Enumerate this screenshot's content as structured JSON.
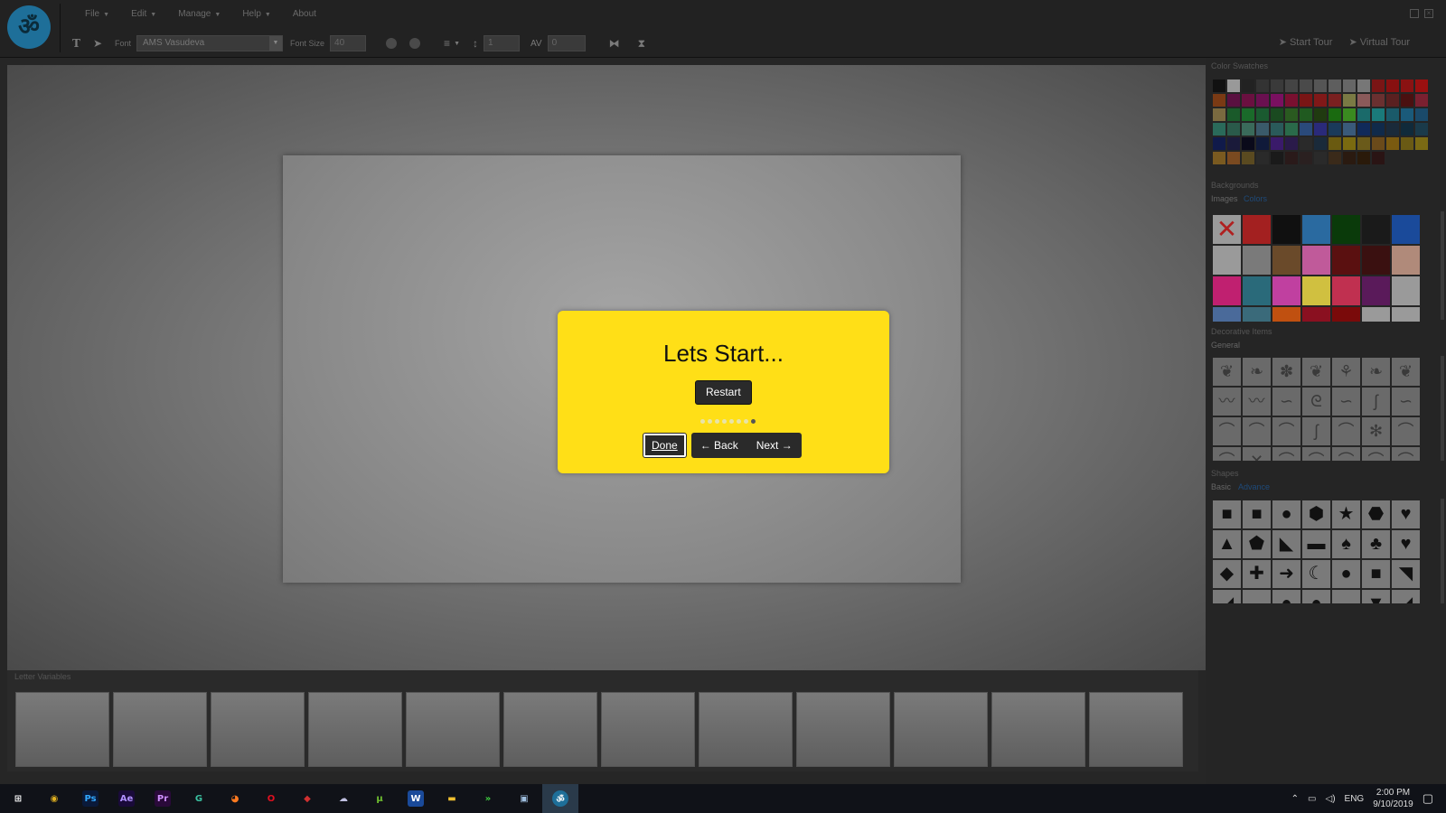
{
  "menu": {
    "items": [
      {
        "label": "File",
        "caret": true
      },
      {
        "label": "Edit",
        "caret": true
      },
      {
        "label": "Manage",
        "caret": true
      },
      {
        "label": "Help",
        "caret": true
      },
      {
        "label": "About",
        "caret": false
      }
    ]
  },
  "toolbar": {
    "font_label": "Font",
    "font_value": "AMS Vasudeva",
    "font_size_label": "Font Size",
    "font_size_value": "40",
    "line_height_value": "1",
    "letter_spacing_value": "0"
  },
  "tour_links": {
    "start": "Start Tour",
    "virtual": "Virtual Tour"
  },
  "tour_dialog": {
    "title": "Lets Start...",
    "restart": "Restart",
    "done": "Done",
    "back": "← Back",
    "next": "Next →",
    "step_count": 8,
    "active_step": 8
  },
  "letter_variables": {
    "title": "Letter Variables",
    "slot_count": 12
  },
  "panel": {
    "color_swatches_title": "Color Swatches",
    "swatch_colors": [
      "#111111",
      "#999999",
      "#222222",
      "#333333",
      "#3a3a3a",
      "#444444",
      "#4a4a4a",
      "#555555",
      "#5e5e5e",
      "#666666",
      "#777777",
      "#7a1515",
      "#881010",
      "#8a1212",
      "#9a1010",
      "#7a3a14",
      "#5a1040",
      "#6a1040",
      "#6a1050",
      "#7a1060",
      "#7a1030",
      "#7a1515",
      "#801818",
      "#7a2020",
      "#7a7a44",
      "#8a5a5a",
      "#6a3030",
      "#5a2020",
      "#4a1010",
      "#7a2030",
      "#7a6a40",
      "#1a5a2a",
      "#1a6a2a",
      "#1a5a30",
      "#1a4a20",
      "#2a5a20",
      "#205a20",
      "#203a10",
      "#1a6a10",
      "#3a8a20",
      "#1a6a6a",
      "#1a7a7a",
      "#1a5a6a",
      "#1a5a7a",
      "#1a4a6a",
      "#2a6a5a",
      "#2a5a4a",
      "#3a6a5a",
      "#3a5a6a",
      "#2a5a5a",
      "#2a6a4a",
      "#2a4a7a",
      "#2a2a7a",
      "#1a3a5a",
      "#3a5a7a",
      "#102a5a",
      "#102a4a",
      "#1a2a3a",
      "#102a3a",
      "#1a3a4a",
      "#101a4a",
      "#1a1a3a",
      "#0a0a1a",
      "#101a3a",
      "#3a1a6a",
      "#2a1a4a",
      "#2a2a2a",
      "#1a2a3a",
      "#6a5a10",
      "#7a6a10",
      "#6a5a1a",
      "#6a4a1a",
      "#7a5a10",
      "#6a5a14",
      "#7a6a14",
      "#7a5a20",
      "#7a4a20",
      "#5a4a20",
      "#2a2a2a",
      "#1a1a1a",
      "#2a1a1a",
      "#2a2020",
      "#2a2a2a",
      "#3a2a1a",
      "#2a1a10",
      "#2a1a0a",
      "#2a1414"
    ],
    "backgrounds_title": "Backgrounds",
    "bg_tabs": {
      "images": "Images",
      "colors": "Colors"
    },
    "bg_thumbs": [
      "#8a8a8a",
      "#a32020",
      "#101010",
      "#2a6aa0",
      "#0a3a0a",
      "#1a1a1a",
      "#1a4a9a",
      "#9a9a9a",
      "#7a7a7a",
      "#6a4a2a",
      "#c05a9a",
      "#5a1010",
      "#3a1010",
      "#b08a7a",
      "#c02070",
      "#2a6a7a",
      "#c040a0",
      "#d0c040",
      "#c03050",
      "#5a1a5a",
      "#9a9a9a",
      "#4a6a9a",
      "#3a6a7a",
      "#c05010",
      "#8a1020",
      "#7a0a0a",
      "#9a9a9a",
      "#9a9a9a"
    ],
    "decorative_title": "Decorative Items",
    "deco_tab": "General",
    "deco_glyphs": [
      "❦",
      "❧",
      "✽",
      "❦",
      "⚘",
      "❧",
      "❦",
      "〰",
      "〰",
      "∽",
      "ᘓ",
      "∽",
      "ʃ",
      "∽",
      "⌒",
      "⌒",
      "⌒",
      "ʃ",
      "⌒",
      "✻",
      "⌒",
      "⌒",
      "✕",
      "⌒",
      "⌒",
      "⌒",
      "⌒",
      "⌒"
    ],
    "shapes_title": "Shapes",
    "shape_tabs": {
      "basic": "Basic",
      "advance": "Advance"
    },
    "shape_glyphs": [
      "■",
      "■",
      "●",
      "⬢",
      "★",
      "⬣",
      "♥",
      "▲",
      "⬟",
      "◣",
      "▬",
      "♠",
      "♣",
      "♥",
      "◆",
      "✚",
      "➜",
      "☾",
      "●",
      "■",
      "◥",
      "◢",
      "▬",
      "●",
      "●",
      "▬",
      "▼",
      "◢"
    ]
  },
  "taskbar": {
    "apps": [
      {
        "name": "windows-start",
        "glyph": "⊞",
        "bg": "transparent",
        "fg": "#ffffff"
      },
      {
        "name": "chrome",
        "glyph": "◉",
        "bg": "transparent",
        "fg": "#e0b020"
      },
      {
        "name": "photoshop",
        "glyph": "Ps",
        "bg": "#0a1a3a",
        "fg": "#31a8ff"
      },
      {
        "name": "after-effects",
        "glyph": "Ae",
        "bg": "#1a0a3a",
        "fg": "#b090ff"
      },
      {
        "name": "premiere",
        "glyph": "Pr",
        "bg": "#2a0a3a",
        "fg": "#d090ff"
      },
      {
        "name": "grammarly",
        "glyph": "G",
        "bg": "transparent",
        "fg": "#3ac0a0"
      },
      {
        "name": "firefox",
        "glyph": "◕",
        "bg": "transparent",
        "fg": "#ff7a20"
      },
      {
        "name": "opera",
        "glyph": "O",
        "bg": "transparent",
        "fg": "#e01020"
      },
      {
        "name": "git",
        "glyph": "◆",
        "bg": "transparent",
        "fg": "#d03030"
      },
      {
        "name": "app-brain",
        "glyph": "☁",
        "bg": "transparent",
        "fg": "#c0c0e0"
      },
      {
        "name": "utorrent",
        "glyph": "μ",
        "bg": "transparent",
        "fg": "#70c030"
      },
      {
        "name": "word",
        "glyph": "W",
        "bg": "#1a4a9a",
        "fg": "#ffffff"
      },
      {
        "name": "file-explorer",
        "glyph": "▬",
        "bg": "transparent",
        "fg": "#f0c030"
      },
      {
        "name": "green-arrow-app",
        "glyph": "»",
        "bg": "transparent",
        "fg": "#40d040"
      },
      {
        "name": "image-viewer",
        "glyph": "▣",
        "bg": "transparent",
        "fg": "#a0c0e0"
      },
      {
        "name": "current-app",
        "glyph": "ॐ",
        "bg": "#1e6f99",
        "fg": "#ffffff"
      }
    ],
    "lang": "ENG",
    "time": "2:00 PM",
    "date": "9/10/2019"
  }
}
